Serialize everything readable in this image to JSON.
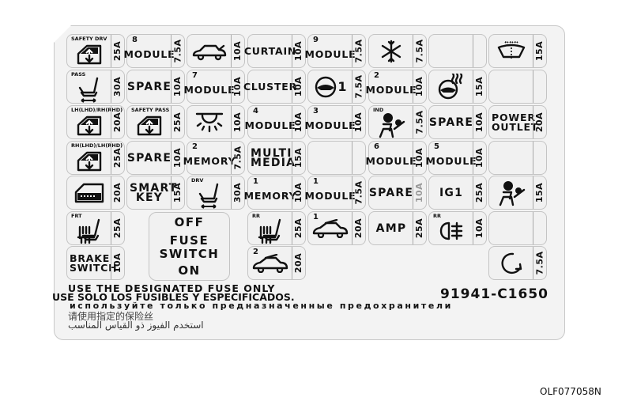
{
  "rows": [
    [
      {
        "tag": "SAFETY DRV",
        "icon": "power-window-icon",
        "amp": "25A"
      },
      {
        "num": "8",
        "label": "MODULE",
        "amp": "7.5A"
      },
      {
        "icon": "trunk-icon",
        "amp": "10A"
      },
      {
        "label": "CURTAIN",
        "amp": "10A"
      },
      {
        "num": "9",
        "label": "MODULE",
        "amp": "7.5A"
      },
      {
        "icon": "snowflake-icon",
        "amp": "7.5A"
      },
      {
        "amp": ""
      },
      {
        "icon": "washer-icon",
        "amp": "15A"
      }
    ],
    [
      {
        "tag": "PASS",
        "icon": "seat-icon",
        "amp": "30A"
      },
      {
        "label": "SPARE",
        "amp": "10A",
        "big": true
      },
      {
        "num": "7",
        "label": "MODULE",
        "amp": "10A"
      },
      {
        "label": "CLUSTER",
        "amp": "10A"
      },
      {
        "icon": "steering-wheel-icon",
        "suffix": "1",
        "amp": "7.5A"
      },
      {
        "num": "2",
        "label": "MODULE",
        "amp": "10A"
      },
      {
        "icon": "heated-steering-wheel-icon",
        "amp": "15A"
      },
      {
        "amp": ""
      }
    ],
    [
      {
        "tag": "LH(LHD)/RH(RHD)",
        "icon": "power-window-icon",
        "amp": "20A"
      },
      {
        "tag": "SAFETY PASS",
        "icon": "power-window-icon",
        "amp": "25A"
      },
      {
        "icon": "room-lamp-icon",
        "amp": "10A"
      },
      {
        "num": "4",
        "label": "MODULE",
        "amp": "10A"
      },
      {
        "num": "3",
        "label": "MODULE",
        "amp": "10A"
      },
      {
        "tag": "IND",
        "icon": "airbag-icon",
        "amp": "7.5A"
      },
      {
        "label": "SPARE",
        "amp": "10A",
        "big": true
      },
      {
        "label": "POWER OUTLET",
        "amp": "20A"
      }
    ],
    [
      {
        "tag": "RH(LHD)/LH(RHD)",
        "icon": "power-window-icon",
        "amp": "25A"
      },
      {
        "label": "SPARE",
        "amp": "10A",
        "big": true
      },
      {
        "num": "2",
        "label": "MEMORY",
        "amp": "7.5A"
      },
      {
        "label": "MULTI MEDIA",
        "amp": "15A",
        "big": true
      },
      {
        "amp": ""
      },
      {
        "num": "6",
        "label": "MODULE",
        "amp": "10A"
      },
      {
        "num": "5",
        "label": "MODULE",
        "amp": "10A"
      },
      {
        "amp": ""
      }
    ],
    [
      {
        "icon": "door-lock-icon",
        "amp": "20A"
      },
      {
        "label": "SMART KEY",
        "amp": "15A",
        "big": true
      },
      {
        "tag": "DRV",
        "icon": "seat-icon",
        "amp": "30A"
      },
      {
        "num": "1",
        "label": "MEMORY",
        "amp": "10A"
      },
      {
        "num": "1",
        "label": "MODULE",
        "amp": "7.5A"
      },
      {
        "label": "SPARE",
        "amp": "10A",
        "big": true,
        "gray_amp": true
      },
      {
        "label": "IG1",
        "amp": "25A",
        "big": true
      },
      {
        "icon": "airbag-icon",
        "amp": "15A"
      }
    ],
    [
      {
        "tag": "FRT",
        "icon": "heated-seat-icon",
        "amp": "25A"
      },
      null,
      null,
      {
        "tag": "RR",
        "icon": "heated-seat-icon",
        "amp": "25A"
      },
      {
        "num": "1",
        "icon": "sunroof-icon",
        "amp": "20A"
      },
      {
        "label": "AMP",
        "amp": "25A",
        "big": true
      },
      {
        "tag": "RR",
        "icon": "fog-lamp-icon",
        "amp": "10A"
      },
      {
        "amp": ""
      }
    ],
    [
      {
        "label": "BRAKE SWITCH",
        "amp": "10A"
      },
      null,
      null,
      {
        "num": "2",
        "icon": "sunroof-icon",
        "amp": "20A"
      },
      null,
      null,
      null,
      {
        "icon": "circular-arrow-icon",
        "amp": "7.5A"
      }
    ]
  ],
  "fuse_switch": {
    "off": "OFF",
    "line1": "FUSE",
    "line2": "SWITCH",
    "on": "ON"
  },
  "notice": {
    "en": "USE THE DESIGNATED FUSE ONLY",
    "es": "USE SOLO LOS FUSIBLES Y ESPECIFICADOS.",
    "ru": "используйте только предназначенные предохранители",
    "zh": "请使用指定的保险丝",
    "ar": "استخدم الفيوز ذو القياس المناسب"
  },
  "part_number": "91941-C1650",
  "figure_code": "OLF077058N"
}
